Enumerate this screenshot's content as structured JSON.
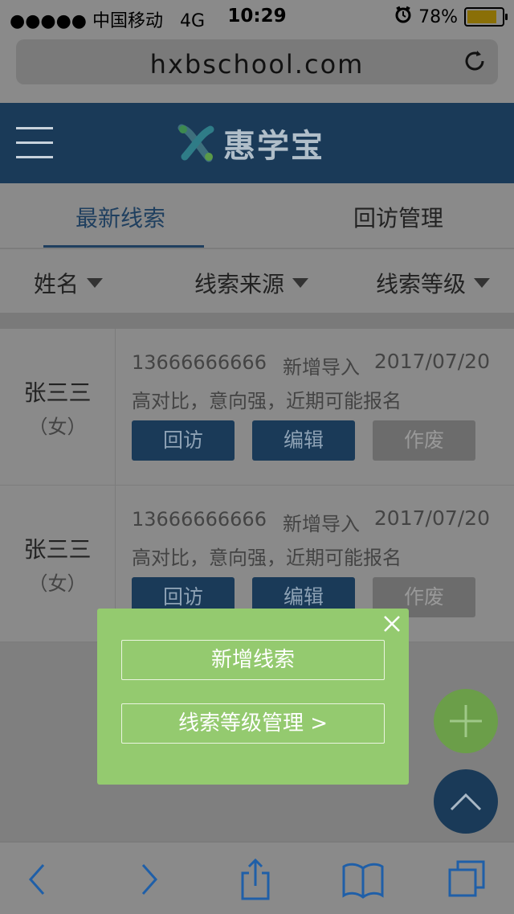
{
  "status_bar": {
    "signal": "●●●●●",
    "carrier": "中国移动",
    "network": "4G",
    "time": "10:29",
    "battery_percent": "78%"
  },
  "browser": {
    "url": "hxbschool.com"
  },
  "app": {
    "logo_text": "惠学宝"
  },
  "tabs": [
    {
      "label": "最新线索",
      "active": true
    },
    {
      "label": "回访管理",
      "active": false
    }
  ],
  "filters": [
    {
      "label": "姓名"
    },
    {
      "label": "线索来源"
    },
    {
      "label": "线索等级"
    }
  ],
  "leads": [
    {
      "name": "张三三",
      "gender": "（女）",
      "phone": "13666666666",
      "source": "新增导入",
      "date": "2017/07/20",
      "note": "高对比，意向强，近期可能报名",
      "btn_visit": "回访",
      "btn_edit": "编辑",
      "btn_void": "作废"
    },
    {
      "name": "张三三",
      "gender": "（女）",
      "phone": "13666666666",
      "source": "新增导入",
      "date": "2017/07/20",
      "note": "高对比，意向强，近期可能报名",
      "btn_visit": "回访",
      "btn_edit": "编辑",
      "btn_void": "作废"
    }
  ],
  "popup": {
    "add_lead": "新增线索",
    "level_manage": "线索等级管理 >"
  },
  "icons": {
    "menu": "hamburger-icon",
    "reload": "reload-icon",
    "close": "close-icon",
    "add": "plus-icon",
    "up": "chevron-up-icon",
    "back": "chevron-left-icon",
    "forward": "chevron-right-icon",
    "share": "share-icon",
    "bookmarks": "book-icon",
    "tabs": "tabs-icon"
  },
  "colors": {
    "brand_dark": "#1a3a58",
    "popup_green": "#94ca6f",
    "toolbar_icon": "#1f5fa8"
  }
}
